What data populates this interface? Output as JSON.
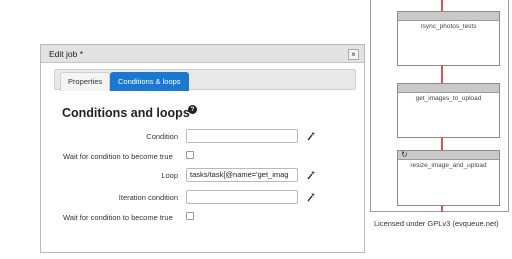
{
  "workflow": {
    "tasks": [
      {
        "name": "rsync_photos_tests"
      },
      {
        "name": "get_images_to_upload"
      },
      {
        "name": "resize_image_and_upload",
        "loop_icon": "loop-icon"
      }
    ],
    "license": "Licensed under GPLv3 (evqueue.net)",
    "wire_color": "#d9534f"
  },
  "dialog": {
    "title": "Edit job *",
    "close_label": "×",
    "tabs": [
      {
        "label": "Properties",
        "active": false
      },
      {
        "label": "Conditions & loops",
        "active": true
      }
    ],
    "heading": "Conditions and loops",
    "help_label": "?",
    "fields": {
      "condition": {
        "label": "Condition",
        "value": ""
      },
      "wait_condition": {
        "label": "Wait for condition to become true",
        "checked": false
      },
      "loop": {
        "label": "Loop",
        "value": "tasks/task[@name='get_imag"
      },
      "iteration_condition": {
        "label": "Iteration condition",
        "value": ""
      },
      "wait_iteration": {
        "label": "Wait for condition to become true",
        "checked": false
      }
    }
  },
  "colors": {
    "accent": "#1a78d0",
    "titlebar": "#e2e2e2"
  }
}
